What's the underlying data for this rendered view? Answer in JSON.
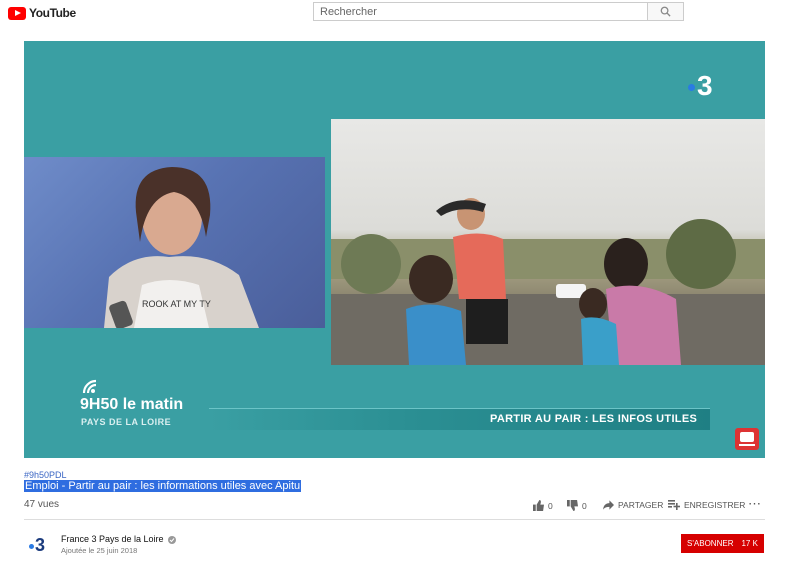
{
  "header": {
    "logo_text": "YouTube",
    "search_placeholder": "Rechercher"
  },
  "player": {
    "channel_logo": "3",
    "show_title": "9H50 le matin",
    "show_subtitle": "PAYS DE LA LOIRE",
    "banner_text": "PARTIR AU PAIR : LES INFOS UTILES"
  },
  "video": {
    "hashtag": "#9h50PDL",
    "title": "Emploi - Partir au pair : les informations utiles avec Apitu",
    "views": "47 vues",
    "likes": "0",
    "dislikes": "0",
    "share_label": "PARTAGER",
    "save_label": "ENREGISTRER"
  },
  "channel": {
    "name": "France 3 Pays de la Loire",
    "logo": "3",
    "date": "Ajoutée le 25 juin 2018",
    "subscribe_label": "S'ABONNER",
    "subscribers": "17 K"
  },
  "colors": {
    "accent": "#ff0000",
    "player_bg": "#3a9fa3",
    "selection": "#2f6de0"
  }
}
